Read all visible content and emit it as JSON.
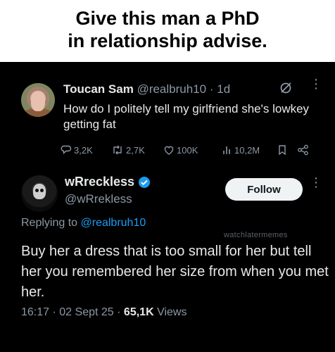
{
  "caption": {
    "line1": "Give this man a PhD",
    "line2": "in relationship advise."
  },
  "original_tweet": {
    "display_name": "Toucan Sam",
    "handle": "@realbruh10",
    "separator": "·",
    "age": "1d",
    "text": "How do I politely tell my girlfriend she's lowkey getting fat",
    "actions": {
      "replies": "3,2K",
      "reposts": "2,7K",
      "likes": "100K",
      "views": "10,2M"
    },
    "icons": [
      "grok-icon",
      "more-icon",
      "reply-icon",
      "repost-icon",
      "like-icon",
      "views-icon",
      "bookmark-icon",
      "share-icon"
    ]
  },
  "reply_tweet": {
    "display_name": "wRreckless",
    "handle": "@wRrekless",
    "verified_color": "#1d9bf0",
    "follow_label": "Follow",
    "replying_prefix": "Replying to",
    "replying_to": "@realbruh10",
    "watermark": "watchlatermemes",
    "text": "Buy her a dress that is too small for her but tell her you remembered her size from when you met her.",
    "time": "16:17",
    "date": "02 Sept 25",
    "views_count": "65,1K",
    "views_label": "Views",
    "separator": "·"
  },
  "colors": {
    "background": "#000000",
    "text_primary": "#e7e9ea",
    "text_muted": "#8b98a5",
    "link": "#1d9bf0",
    "caption_bg": "#ffffff"
  }
}
